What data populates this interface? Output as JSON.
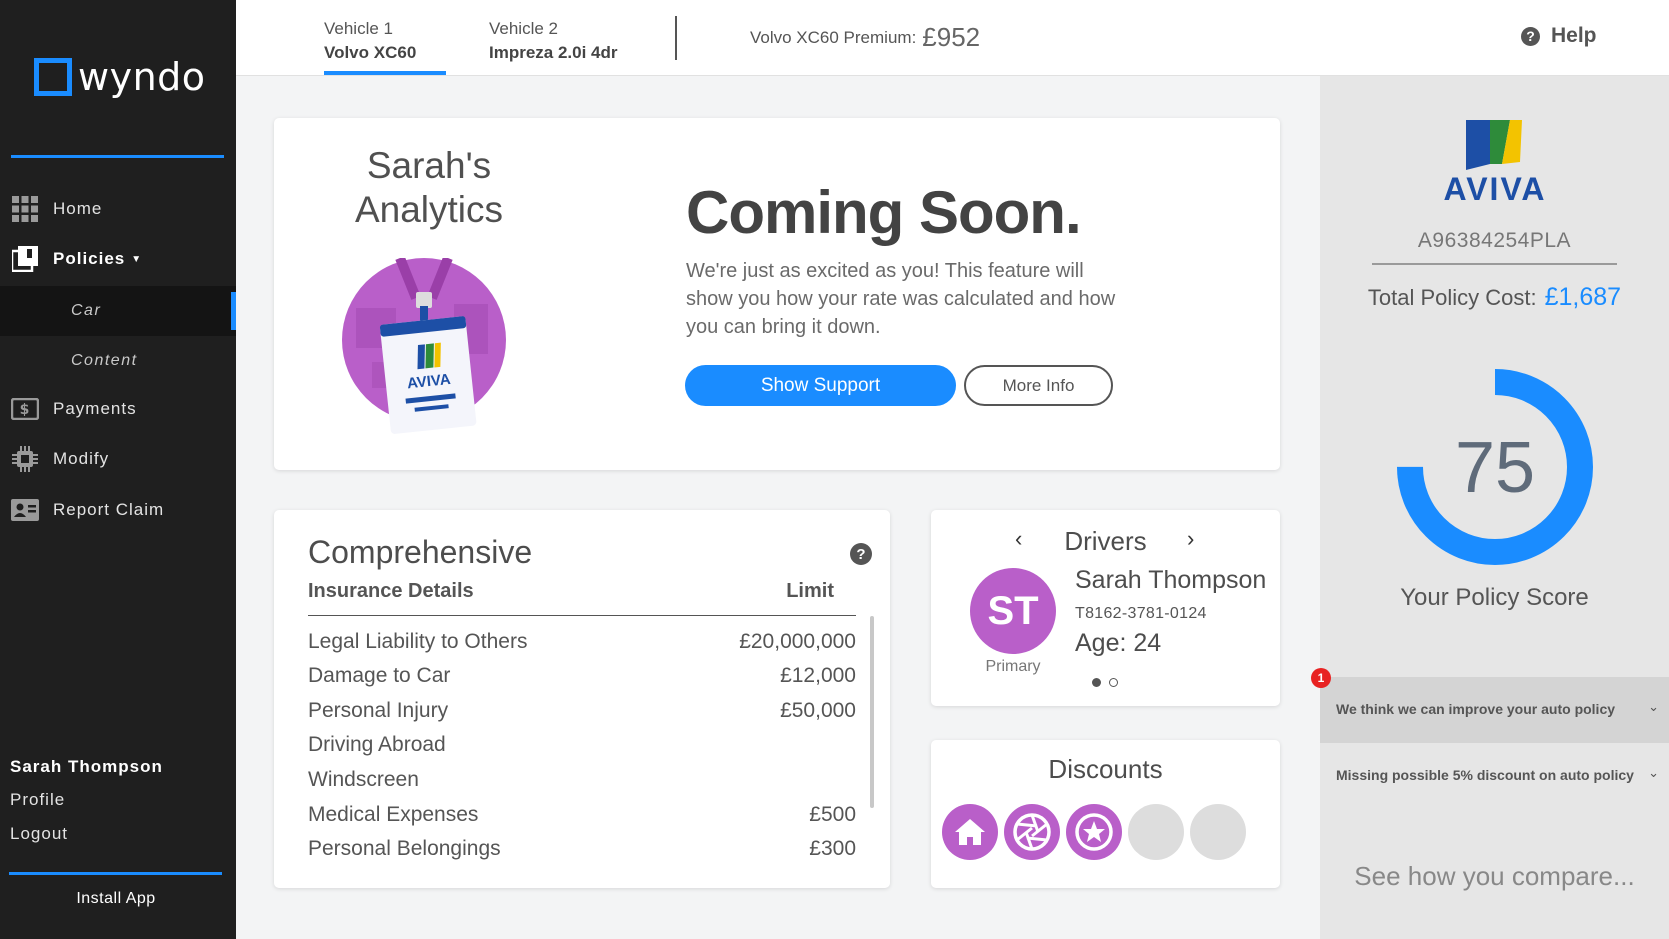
{
  "brand": {
    "name": "wyndo",
    "accent": "#1a8cff"
  },
  "sidebar": {
    "items": [
      {
        "label": "Home",
        "icon": "grid-icon"
      },
      {
        "label": "Policies",
        "icon": "policies-icon"
      },
      {
        "label": "Payments",
        "icon": "payment-icon"
      },
      {
        "label": "Modify",
        "icon": "chip-icon"
      },
      {
        "label": "Report Claim",
        "icon": "id-card-icon"
      }
    ],
    "subitems": [
      {
        "label": "Car",
        "active": true
      },
      {
        "label": "Content",
        "active": false
      }
    ],
    "user_name": "Sarah Thompson",
    "profile_label": "Profile",
    "logout_label": "Logout",
    "install_label": "Install App"
  },
  "topbar": {
    "vehicles": [
      {
        "label": "Vehicle 1",
        "name": "Volvo XC60",
        "active": true
      },
      {
        "label": "Vehicle 2",
        "name": "Impreza 2.0i 4dr",
        "active": false
      }
    ],
    "premium_label": "Volvo XC60 Premium:",
    "premium_value": "£952",
    "help_label": "Help"
  },
  "analytics": {
    "title_line1": "Sarah's",
    "title_line2": "Analytics",
    "badge_brand": "AVIVA",
    "heading": "Coming Soon.",
    "description": "We're just as excited as you! This feature will show you how your rate was calculated and how you can bring it down.",
    "support_button": "Show Support",
    "more_button": "More Info"
  },
  "coverage": {
    "title": "Comprehensive",
    "col_details": "Insurance Details",
    "col_limit": "Limit",
    "rows": [
      {
        "name": "Legal Liability to Others",
        "limit": "£20,000,000"
      },
      {
        "name": "Damage to Car",
        "limit": "£12,000"
      },
      {
        "name": "Personal Injury",
        "limit": "£50,000"
      },
      {
        "name": "Driving Abroad",
        "limit": ""
      },
      {
        "name": "Windscreen",
        "limit": ""
      },
      {
        "name": "Medical Expenses",
        "limit": "£500"
      },
      {
        "name": "Personal Belongings",
        "limit": "£300"
      }
    ]
  },
  "drivers": {
    "title": "Drivers",
    "initials": "ST",
    "role": "Primary",
    "name": "Sarah Thompson",
    "license": "T8162-3781-0124",
    "age": "Age: 24",
    "page_count": 2,
    "current_page": 1,
    "avatar_color": "#b95fc9"
  },
  "discounts": {
    "title": "Discounts",
    "items": [
      {
        "icon": "home-icon",
        "active": true
      },
      {
        "icon": "aperture-icon",
        "active": true
      },
      {
        "icon": "star-icon",
        "active": true
      },
      {
        "icon": "empty-slot",
        "active": false
      },
      {
        "icon": "empty-slot",
        "active": false
      }
    ],
    "active_color": "#b95fc9",
    "inactive_color": "#dddddd"
  },
  "policy": {
    "insurer": "AVIVA",
    "number": "A96384254PLA",
    "total_label": "Total Policy Cost:",
    "total_value": "£1,687",
    "score": "75",
    "score_fraction": 0.75,
    "score_label": "Your Policy Score",
    "alerts": [
      {
        "text": "We think we can improve your auto policy",
        "badge": "1"
      },
      {
        "text": "Missing possible 5% discount on auto policy",
        "badge": ""
      }
    ],
    "compare_label": "See how you compare..."
  }
}
